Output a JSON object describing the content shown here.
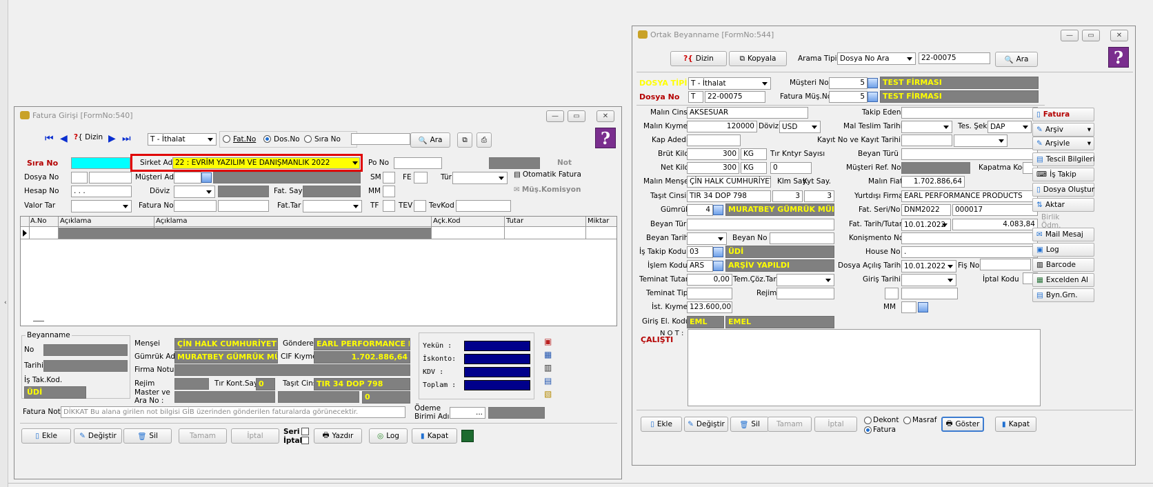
{
  "fatura": {
    "title": "Fatura Girişi [FormNo:540]",
    "toolbar": {
      "dizin": "Dizin",
      "tip": "T - İthalat",
      "r_fatno": "Fat.No",
      "r_dosno": "Dos.No",
      "r_sirano": "Sıra No",
      "ara": "Ara"
    },
    "labels": {
      "sira_no": "Sıra No",
      "sirket_adi": "Sirket Adı",
      "po_no": "Po No",
      "not": "Not",
      "dosya_no": "Dosya No",
      "musteri_adi": "Müşteri Adı",
      "sm": "SM",
      "fe": "FE",
      "tur": "Tür",
      "otomatik": "Otomatik Fatura",
      "hesap_no": "Hesap No",
      "doviz": "Döviz",
      "fat_say": "Fat. Say",
      "mm": "MM",
      "mus_komisyon": "Müş.Komisyon",
      "valor_tar": "Valor Tar",
      "fatura_no": "Fatura No",
      "fat_tar": "Fat.Tar",
      "tf": "TF",
      "tev": "TEV",
      "tevkod": "TevKod"
    },
    "values": {
      "sirket_adi": "22 : EVRİM YAZILIM  VE DANIŞMANLIK 2022",
      "hesap_no": " .  .  ."
    },
    "grid_cols": [
      "A.No",
      "Açıklama",
      "Açıklama",
      "Açk.Kod",
      "Tutar",
      "Miktar"
    ],
    "beyanname": {
      "group": "Beyanname",
      "no": "No",
      "tarihi": "Tarihi",
      "is_tak_kod": "İş Tak.Kod.",
      "is_tak_val": "ÜDİ"
    },
    "mid": {
      "mensei": "Menşei",
      "mensei_val": "ÇİN HALK CUMHURİYETİ",
      "gonderen": "Gönderen",
      "gonderen_val": "EARL PERFORMANCE P",
      "gumruk_adi": "Gümrük Adı",
      "gumruk_val": "MURATBEY GÜMRÜK MÜI",
      "cif": "CIF Kıymet",
      "cif_val": "1.702.886,64",
      "firma_notu": "Firma Notu",
      "rejim": "Rejim",
      "tir": "Tır Kont.Say",
      "tir_val": "0",
      "tasit": "Taşıt Cinsi",
      "tasit_val": "TIR 34 DOP 798",
      "master1": "Master ve",
      "master2": "Ara No :",
      "master_val": "0"
    },
    "totals": {
      "yekun": "Yekün   :",
      "iskonto": "İskonto:",
      "kdv": "KDV     :",
      "toplam": "Toplam  :"
    },
    "fatura_not": "Fatura Not",
    "fatura_not_val": "DİKKAT Bu alana girilen not bilgisi GİB üzerinden gönderilen faturalarda görünecektir.",
    "odeme1": "Ödeme",
    "odeme2": "Birimi Adı",
    "odeme_val": "...",
    "bottom": {
      "ekle": "Ekle",
      "degistir": "Değiştir",
      "sil": "Sil",
      "tamam": "Tamam",
      "iptal": "İptal",
      "seri": "Seri",
      "iptal_chk": "İptal",
      "yazdir": "Yazdır",
      "log": "Log",
      "kapat": "Kapat"
    }
  },
  "ortak": {
    "title": "Ortak Beyanname [FormNo:544]",
    "toolbar": {
      "dizin": "Dizin",
      "kopyala": "Kopyala",
      "arama_tipi": "Arama Tipi",
      "arama_sel": "Dosya No Ara",
      "arama_val": "22-00075",
      "ara": "Ara"
    },
    "top": {
      "dosya_tipi": "DOSYA TİPİ",
      "dosya_tipi_val": "T - İthalat",
      "musteri_no": "Müşteri No",
      "musteri_no_val": "5",
      "firma1": "TEST FİRMASI",
      "dosya_no": "Dosya No",
      "dosya_no_pre": "T",
      "dosya_no_val": "22-00075",
      "fatura_mus": "Fatura Müş.No",
      "fatura_mus_val": "5",
      "firma2": "TEST FİRMASI"
    },
    "left": {
      "malin_cinsi": "Malın Cinsi",
      "malin_cinsi_val": "AKSESUAR",
      "malin_kiymeti": "Malın Kıymeti",
      "malin_kiymeti_val": "120000",
      "doviz": "Döviz",
      "doviz_val": "USD",
      "kap_adedi": "Kap Adedi",
      "brut_kilo": "Brüt Kilo",
      "brut_kilo_val": "300",
      "brut_unit": "KG",
      "tir_kntyr": "Tır Kntyr Sayısı",
      "net_kilo": "Net Kilo",
      "net_kilo_val": "300",
      "net_unit": "KG",
      "tir_val": "0",
      "malin_mensei": "Malın Menşei",
      "malin_mensei_val": "ÇİN HALK CUMHURİYETİ",
      "klm_say": "Klm Say.",
      "kyt_say": "Kyt Say.",
      "tasit_cinsi": "Taşıt Cinsi",
      "tasit_val": "TIR 34 DOP 798",
      "klm_val": "3",
      "kyt_val": "3",
      "gumruk": "Gümrük",
      "gumruk_no": "4",
      "gumruk_val": "MURATBEY GÜMRÜK MÜDÜ",
      "beyan_turu": "Beyan Türü",
      "beyan_tarihi": "Beyan Tarihi",
      "beyan_no": "Beyan No",
      "is_takip_kodu": "İş Takip Kodu",
      "is_takip_no": "03",
      "is_takip_val": "ÜDİ",
      "islem_kodu": "İşlem Kodu",
      "islem_no": "ARS",
      "islem_val": "ARŞİV YAPILDI",
      "teminat_tutari": "Teminat Tutarı",
      "teminat_val": "0,00",
      "tem_coz": "Tem.Çöz.Tar.",
      "teminat_tipi": "Teminat Tipi",
      "rejim": "Rejim",
      "ist_kiymet": "İst. Kıymet",
      "ist_val": "123.600,00",
      "giris_el": "Giriş El. Kodu",
      "giris_el_no": "EML",
      "giris_el_val": "EMEL",
      "not": "N O T :",
      "calisti": "ÇALIŞTI"
    },
    "right": {
      "takip_eden": "Takip Eden",
      "mal_teslim": "Mal Teslim Tarihi",
      "tes_sekli": "Tes. Şekli",
      "tes_val": "DAP",
      "kayit": "Kayıt  No  ve Kayıt Tarihi",
      "beyan_turu2": "Beyan Türü 2",
      "musteri_ref": "Müşteri  Ref. No",
      "kapatma": "Kapatma Kod",
      "malin_fiati": "Malın Fiatı",
      "malin_fiati_val": "1.702.886,64",
      "yurtdisi": "Yurtdışı Firma",
      "yurtdisi_val": "EARL PERFORMANCE PRODUCTS",
      "fat_seri": "Fat. Seri/No",
      "fat_seri_val": "DNM2022",
      "fat_no_val": "000017",
      "fat_tarih": "Fat. Tarih/Tutar",
      "fat_tarih_val": "10.01.2022",
      "fat_tutar_val": "4.083,84",
      "konismento": "Konişmento No",
      "house": "House No",
      "house_val": ".",
      "dosya_acilis": "Dosya Açılış Tarihi",
      "dosya_acilis_val": "10.01.2022",
      "fis_no": "Fiş No",
      "giris_tarihi": "Giriş Tarihi",
      "iptal_kodu": "İptal Kodu",
      "mm": "MM"
    },
    "side": [
      "Fatura",
      "Arşiv",
      "Arşivle",
      "Tescil Bilgileri",
      "İş Takip",
      "Dosya Oluştur",
      "Aktar",
      "Birlik Ödm.",
      "Mail Mesaj",
      "Log",
      "Barcode",
      "Excelden Al",
      "Byn.Grn."
    ],
    "bottom": {
      "ekle": "Ekle",
      "degistir": "Değiştir",
      "sil": "Sil",
      "tamam": "Tamam",
      "iptal": "İptal",
      "dekont": "Dekont",
      "masraf": "Masraf",
      "fatura": "Fatura",
      "goster": "Göster",
      "kapat": "Kapat"
    }
  }
}
